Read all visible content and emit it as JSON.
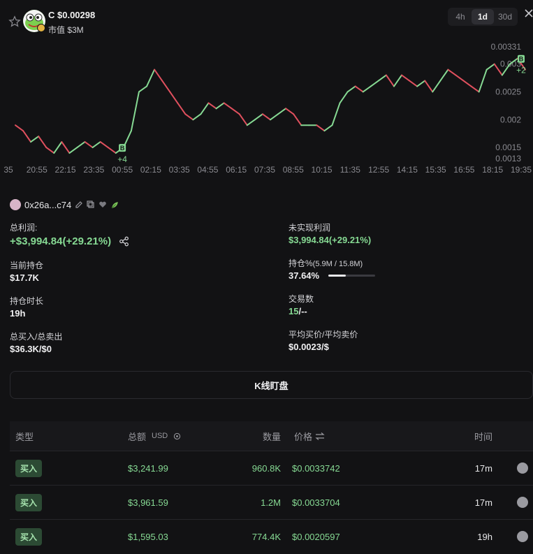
{
  "header": {
    "token_symbol": "C",
    "token_price": "$0.00298",
    "title": "C $0.00298",
    "market_cap_label": "市值",
    "market_cap_value": "$3M",
    "market_cap": "市值 $3M",
    "timeframes": [
      "4h",
      "1d",
      "30d"
    ],
    "active_timeframe": "1d"
  },
  "chart_data": {
    "type": "line",
    "x_ticks": [
      "35",
      "20:55",
      "22:15",
      "23:35",
      "00:55",
      "02:15",
      "03:35",
      "04:55",
      "06:15",
      "07:35",
      "08:55",
      "10:15",
      "11:35",
      "12:55",
      "14:15",
      "15:35",
      "16:55",
      "18:15",
      "19:35"
    ],
    "y_ticks": [
      "0.00331",
      "0.003",
      "0.0025",
      "0.002",
      "0.0015",
      "0.0013"
    ],
    "ylim": [
      0.0013,
      0.00331
    ],
    "colors": {
      "up": "#86d993",
      "down": "#e0505e"
    },
    "markers": [
      {
        "label": "B",
        "note": "+4",
        "x": "00:55"
      },
      {
        "label": "B",
        "note": "+2",
        "x": "19:35"
      }
    ],
    "series": [
      {
        "values": [
          0.0019,
          0.0018,
          0.0016,
          0.0017,
          0.0015,
          0.0014,
          0.0016,
          0.0014,
          0.0015,
          0.0016,
          0.0015,
          0.0016,
          0.0015,
          0.0014,
          0.0015,
          0.0018,
          0.0025,
          0.0026,
          0.0029,
          0.0027,
          0.0025,
          0.0023,
          0.0021,
          0.002,
          0.0021,
          0.0023,
          0.0022,
          0.0023,
          0.0022,
          0.0021,
          0.0019,
          0.002,
          0.0021,
          0.002,
          0.0021,
          0.0022,
          0.0021,
          0.0019,
          0.0019,
          0.0019,
          0.0018,
          0.0019,
          0.0023,
          0.0025,
          0.0026,
          0.0025,
          0.0026,
          0.0027,
          0.0028,
          0.0026,
          0.0028,
          0.0027,
          0.0026,
          0.0027,
          0.0025,
          0.0027,
          0.0029,
          0.0028,
          0.0027,
          0.0026,
          0.0025,
          0.0029,
          0.003,
          0.0028,
          0.003,
          0.0031,
          0.0029
        ]
      }
    ]
  },
  "wallet": {
    "address": "0x26a...c74"
  },
  "stats": {
    "total_profit_label": "总利润:",
    "total_profit_value": "+$3,994.84(+29.21%)",
    "unrealized_label": "未实现利润",
    "unrealized_value": "$3,994.84(+29.21%)",
    "holding_label": "当前持仓",
    "holding_value": "$17.7K",
    "holding_pct_label": "持仓%",
    "holding_pct_detail": "(5.9M / 15.8M)",
    "holding_pct_value": "37.64%",
    "holding_pct_fraction": 0.3764,
    "duration_label": "持仓时长",
    "duration_value": "19h",
    "trades_label": "交易数",
    "trades_buy": "15",
    "trades_sell": "/--",
    "buy_sell_label": "总买入/总卖出",
    "buy_sell_value": "$36.3K/$0",
    "avg_price_label": "平均买价/平均卖价",
    "avg_price_value": "$0.0023/$"
  },
  "kline_button": "K线盯盘",
  "table": {
    "headers": {
      "type": "类型",
      "amount": "总额",
      "currency": "USD",
      "qty": "数量",
      "price": "价格",
      "time": "时间"
    },
    "rows": [
      {
        "type": "买入",
        "amount": "$3,241.99",
        "qty": "960.8K",
        "price": "$0.0033742",
        "time": "17m"
      },
      {
        "type": "买入",
        "amount": "$3,961.59",
        "qty": "1.2M",
        "price": "$0.0033704",
        "time": "17m"
      },
      {
        "type": "买入",
        "amount": "$1,595.03",
        "qty": "774.4K",
        "price": "$0.0020597",
        "time": "19h"
      }
    ]
  }
}
